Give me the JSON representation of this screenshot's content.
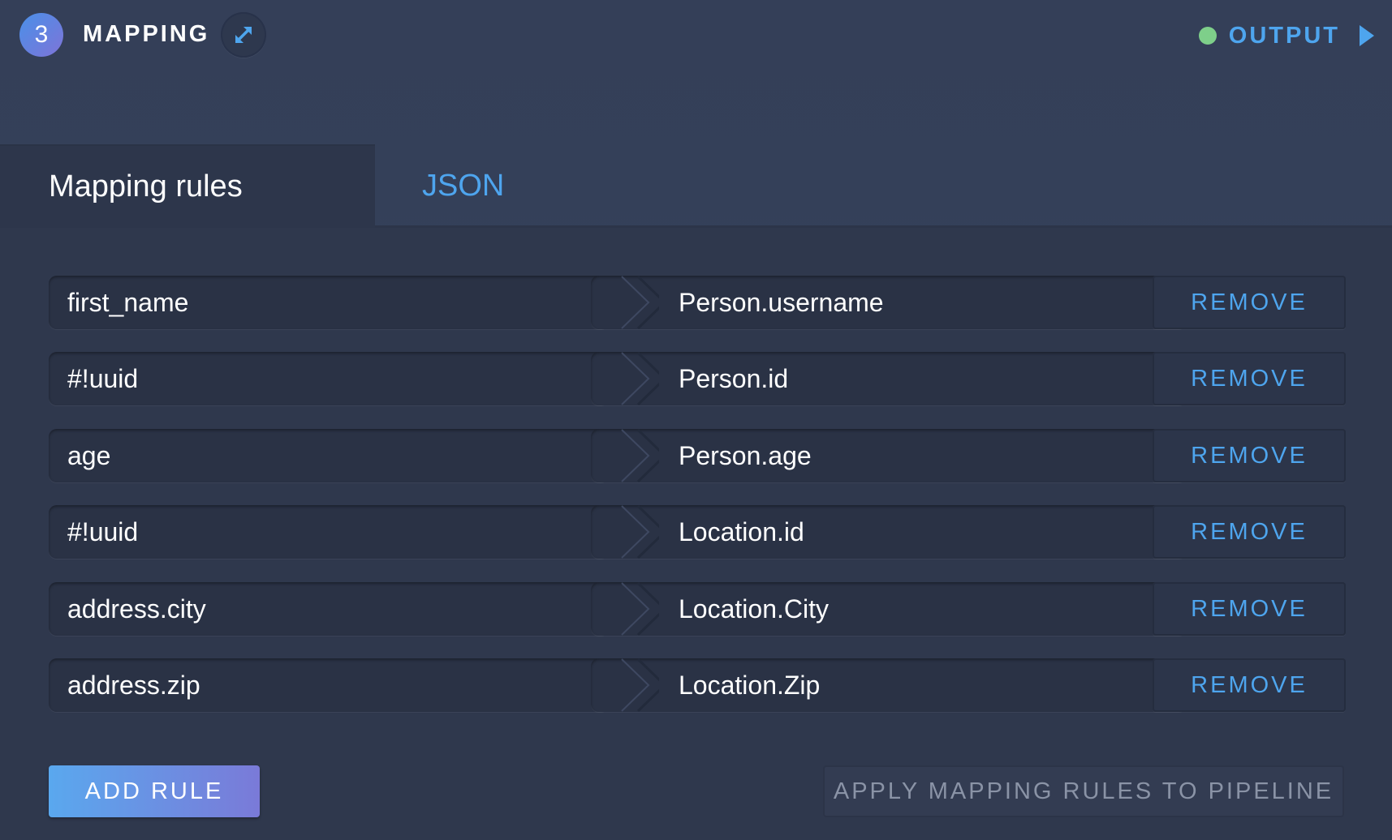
{
  "header": {
    "step_number": "3",
    "title": "MAPPING",
    "expand_icon": "expand-arrows-icon",
    "output_label": "OUTPUT",
    "status_color": "#7ecf8a"
  },
  "tabs": [
    {
      "label": "Mapping rules",
      "active": true
    },
    {
      "label": "JSON",
      "active": false
    }
  ],
  "rules": [
    {
      "source": "first_name",
      "target": "Person.username",
      "remove_label": "REMOVE"
    },
    {
      "source": "#!uuid",
      "target": "Person.id",
      "remove_label": "REMOVE"
    },
    {
      "source": "age",
      "target": "Person.age",
      "remove_label": "REMOVE"
    },
    {
      "source": "#!uuid",
      "target": "Location.id",
      "remove_label": "REMOVE"
    },
    {
      "source": "address.city",
      "target": "Location.City",
      "remove_label": "REMOVE"
    },
    {
      "source": "address.zip",
      "target": "Location.Zip",
      "remove_label": "REMOVE"
    }
  ],
  "actions": {
    "add_rule_label": "ADD RULE",
    "apply_label": "APPLY MAPPING RULES TO PIPELINE"
  },
  "colors": {
    "accent": "#4ea5ee",
    "background": "#343f58",
    "field_background": "#2a3245"
  }
}
